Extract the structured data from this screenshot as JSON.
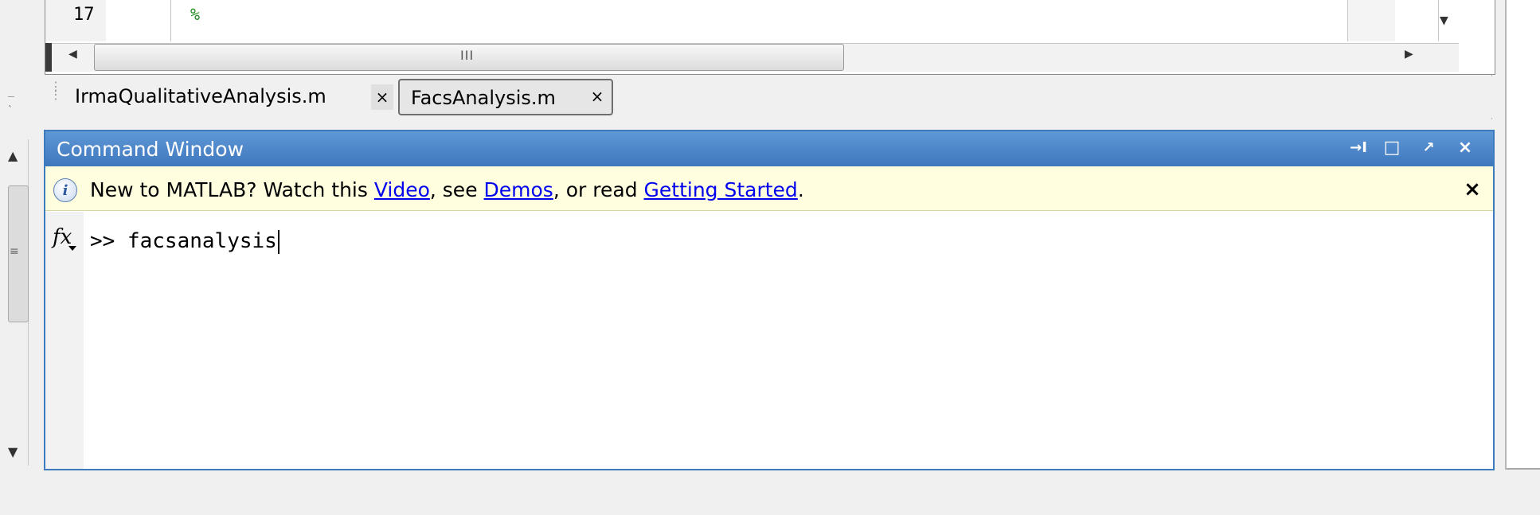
{
  "editor": {
    "line_number": "17",
    "line_code": "%",
    "h_scroll_grip": "III"
  },
  "tabs": [
    {
      "label": "IrmaQualitativeAnalysis.m",
      "close": "×",
      "active": false
    },
    {
      "label": "FacsAnalysis.m",
      "close": "×",
      "active": true
    }
  ],
  "command_window": {
    "title": "Command Window",
    "toolbar": {
      "undock_icon": "→I",
      "maximize_icon": "□",
      "popout_icon": "↗",
      "close_icon": "×"
    },
    "info_bar": {
      "text_1": "New to MATLAB? Watch this ",
      "link_video": "Video",
      "text_2": ", see ",
      "link_demos": "Demos",
      "text_3": ", or read ",
      "link_getting_started": "Getting Started",
      "text_4": ".",
      "close": "×"
    },
    "fx_label": "fx",
    "prompt": ">> ",
    "input": "facsanalysis"
  },
  "colors": {
    "title_bar": "#3f77bd",
    "info_bar_bg": "#ffffe0",
    "link": "#0000ee",
    "comment": "#228b22"
  }
}
